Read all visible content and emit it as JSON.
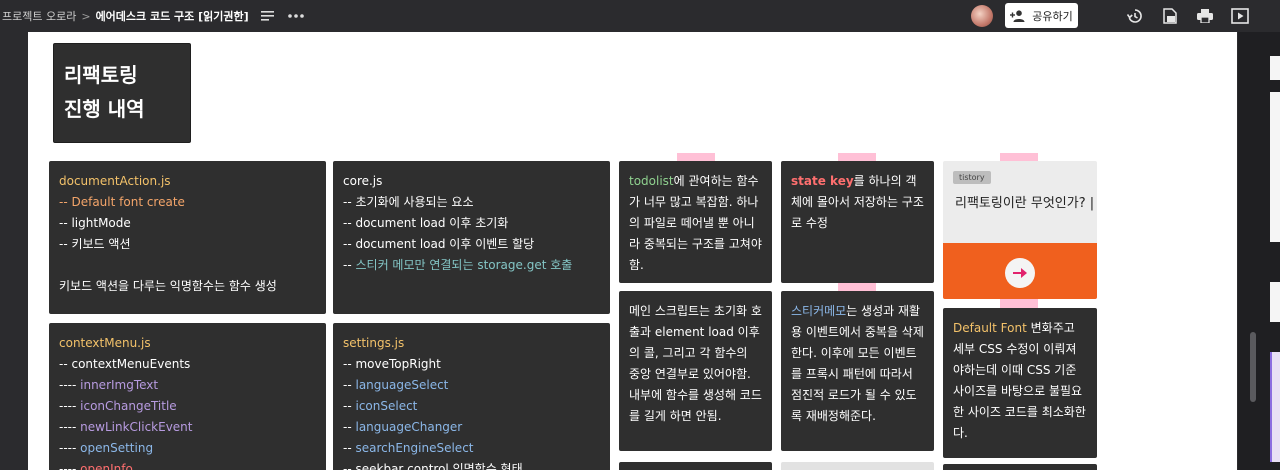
{
  "topbar": {
    "workspace": "프로젝트 오로라",
    "separator": ">",
    "doc_title": "에어데스크 코드 구조 [읽기권한]",
    "share_label": "공유하기"
  },
  "title_box": {
    "line1": "리팩토링",
    "line2": "진행 내역"
  },
  "cards": {
    "documentAction": {
      "file": "documentAction.js",
      "l1_prefix": "-- ",
      "l1_text": "Default font create",
      "l2": "-- lightMode",
      "l3": "-- 키보드 액션",
      "l4": "키보드 액션을 다루는 익명함수는 함수 생성"
    },
    "core": {
      "file": "core.js",
      "l1": "-- 초기화에 사용되는 요소",
      "l2": "-- document load 이후 초기화",
      "l3": "-- document load 이후 이벤트 할당",
      "l4_prefix": "-- ",
      "l4_text": "스티커 메모만 연결되는 storage.get 호출"
    },
    "contextMenu": {
      "file": "contextMenu.js",
      "l1": "-- contextMenuEvents",
      "items": [
        {
          "prefix": "---- ",
          "text": "innerImgText"
        },
        {
          "prefix": "---- ",
          "text": "iconChangeTitle"
        },
        {
          "prefix": "---- ",
          "text": "newLinkClickEvent"
        },
        {
          "prefix": "---- ",
          "text": "openSetting"
        },
        {
          "prefix": "---- ",
          "text": "openInfo"
        }
      ]
    },
    "settings": {
      "file": "settings.js",
      "l1": "-- moveTopRight",
      "items": [
        {
          "prefix": "-- ",
          "text": "languageSelect"
        },
        {
          "prefix": "-- ",
          "text": "iconSelect"
        },
        {
          "prefix": "-- ",
          "text": "languageChanger"
        },
        {
          "prefix": "-- ",
          "text": "searchEngineSelect"
        },
        {
          "prefix": "-- ",
          "text": "seekbar control 익명함수 형태"
        }
      ]
    },
    "todolist": {
      "highlight": "todolist",
      "text": "에 관여하는 함수가 너무 많고 복잡함. 하나의 파일로 떼어낼 뿐 아니라 중복되는 구조를 고쳐야함."
    },
    "statekey": {
      "highlight": "state key",
      "text": "를 하나의 객체에 몰아서 저장하는 구조로 수정"
    },
    "mainscript": {
      "text": "메인 스크립트는 초기화 호출과 element load 이후의 콜, 그리고 각 함수의 중앙 연결부로 있어야함. 내부에 함수를 생성해 코드를 길게 하면 안됨."
    },
    "stickermemo": {
      "highlight": "스티커메모",
      "text": "는 생성과 재활용 이벤트에서 중복을 삭제한다. 이후에 모든 이벤트를 프록시 패턴에 따라서 점진적 로드가 될 수 있도록 재배정해준다."
    },
    "defaultfont": {
      "highlight": "Default Font",
      "text": " 변화주고 세부 CSS 수정이 이뤄져야하는데 이때 CSS 기준 사이즈를 바탕으로 불필요한 사이즈 코드를 최소화한다."
    },
    "tistory": {
      "tag": "tistory",
      "title": "리팩토링이란 무엇인가? |"
    }
  },
  "colors": {
    "yellow": "#f3c26a",
    "orange": "#f4a56a",
    "blue": "#8bb7e8",
    "purple": "#b79be0",
    "green": "#8fd18f",
    "teal": "#84c6c6",
    "red": "#ff6f6f",
    "card_bg": "#2f2f2f",
    "tistory_orange": "#f0601e"
  },
  "icons": [
    "list-icon",
    "more-icon",
    "add-person-icon",
    "history-icon",
    "export-icon",
    "print-icon",
    "present-icon",
    "arrow-right-icon"
  ]
}
